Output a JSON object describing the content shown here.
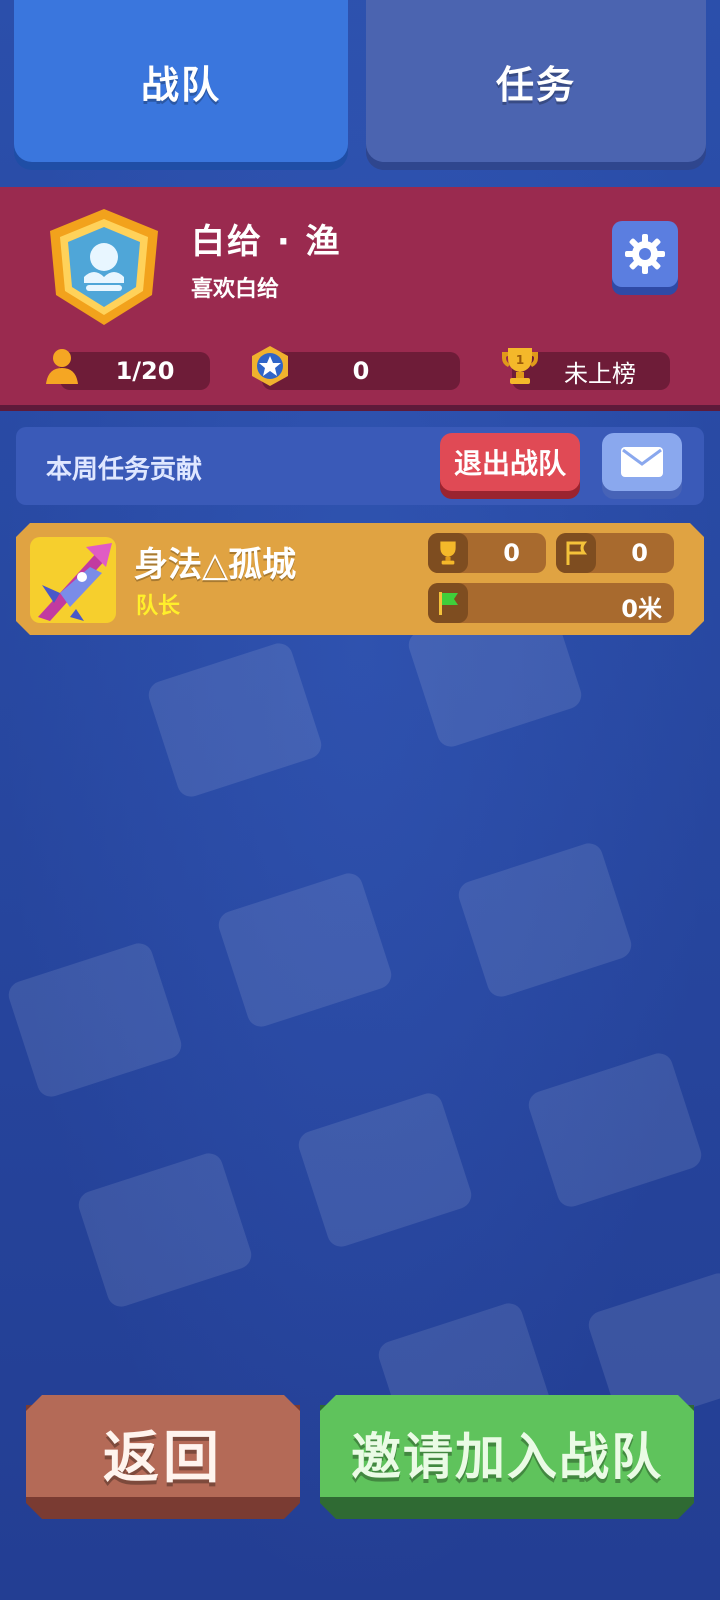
{
  "tabs": [
    {
      "label": "战队"
    },
    {
      "label": "任务"
    }
  ],
  "team": {
    "name": "白给 · 渔",
    "motto": "喜欢白给",
    "members": "1/20",
    "stars": "0",
    "rank": "未上榜"
  },
  "contrib": {
    "label": "本周任务贡献",
    "quit_label": "退出战队"
  },
  "member": {
    "name": "身法△孤城",
    "role": "队长",
    "trophies": "0",
    "flags": "0",
    "distance": "0米"
  },
  "buttons": {
    "back": "返回",
    "invite": "邀请加入战队"
  },
  "icons": {
    "badge": "team-badge-icon",
    "settings": "gear-icon",
    "members": "person-icon",
    "stars": "star-medal-icon",
    "rank": "trophy-icon",
    "mail": "mail-icon",
    "flag": "green-flag-icon"
  },
  "colors": {
    "tab_active": "#3a76dd",
    "tab_inactive": "#4b64b0",
    "team_panel": "#9a2a4f",
    "member_card": "#e0a342",
    "quit": "#e04a55",
    "invite": "#5fc35c",
    "back": "#b46a57"
  }
}
